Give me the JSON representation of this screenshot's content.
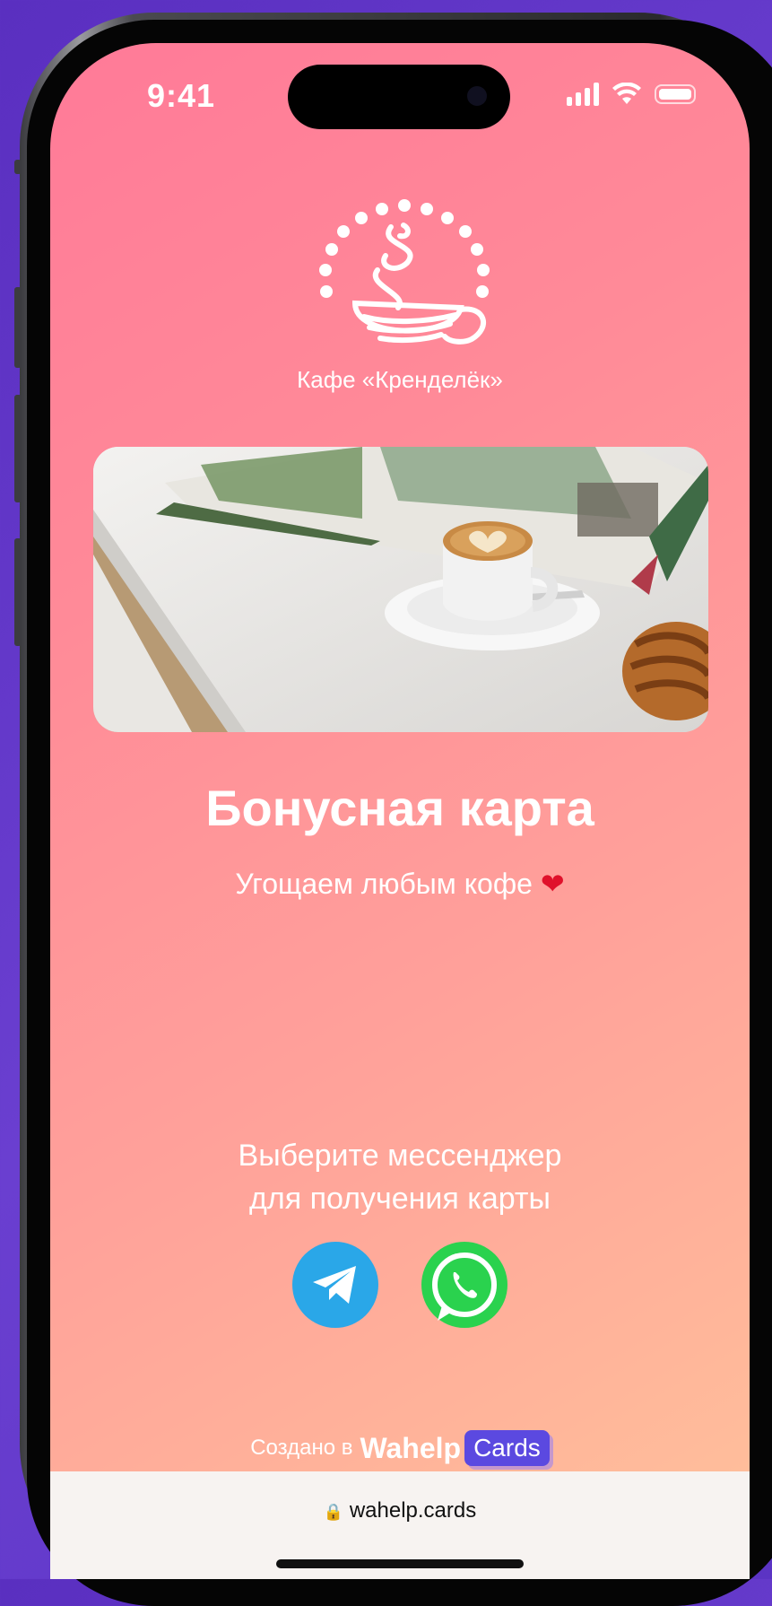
{
  "status_bar": {
    "time": "9:41"
  },
  "cafe": {
    "name": "Кафе «Кренделёк»"
  },
  "card": {
    "title": "Бонусная карта",
    "subtitle": "Угощаем любым кофе",
    "subtitle_emoji": "❤"
  },
  "messenger": {
    "prompt_line1": "Выберите мессенджер",
    "prompt_line2": "для получения карты",
    "options": [
      {
        "icon": "telegram-icon",
        "color": "#2aa7e8"
      },
      {
        "icon": "whatsapp-icon",
        "color": "#2ad24e"
      }
    ]
  },
  "footer": {
    "made_in": "Создано в",
    "brand": "Wahelp",
    "brand_badge": "Cards"
  },
  "address_bar": {
    "url": "wahelp.cards"
  },
  "colors": {
    "background": "#5a2fc0",
    "gradient_start": "#ff7a98",
    "gradient_end": "#ffc29c",
    "telegram": "#2aa7e8",
    "whatsapp": "#2ad24e",
    "brand_badge": "#5b49e0"
  }
}
